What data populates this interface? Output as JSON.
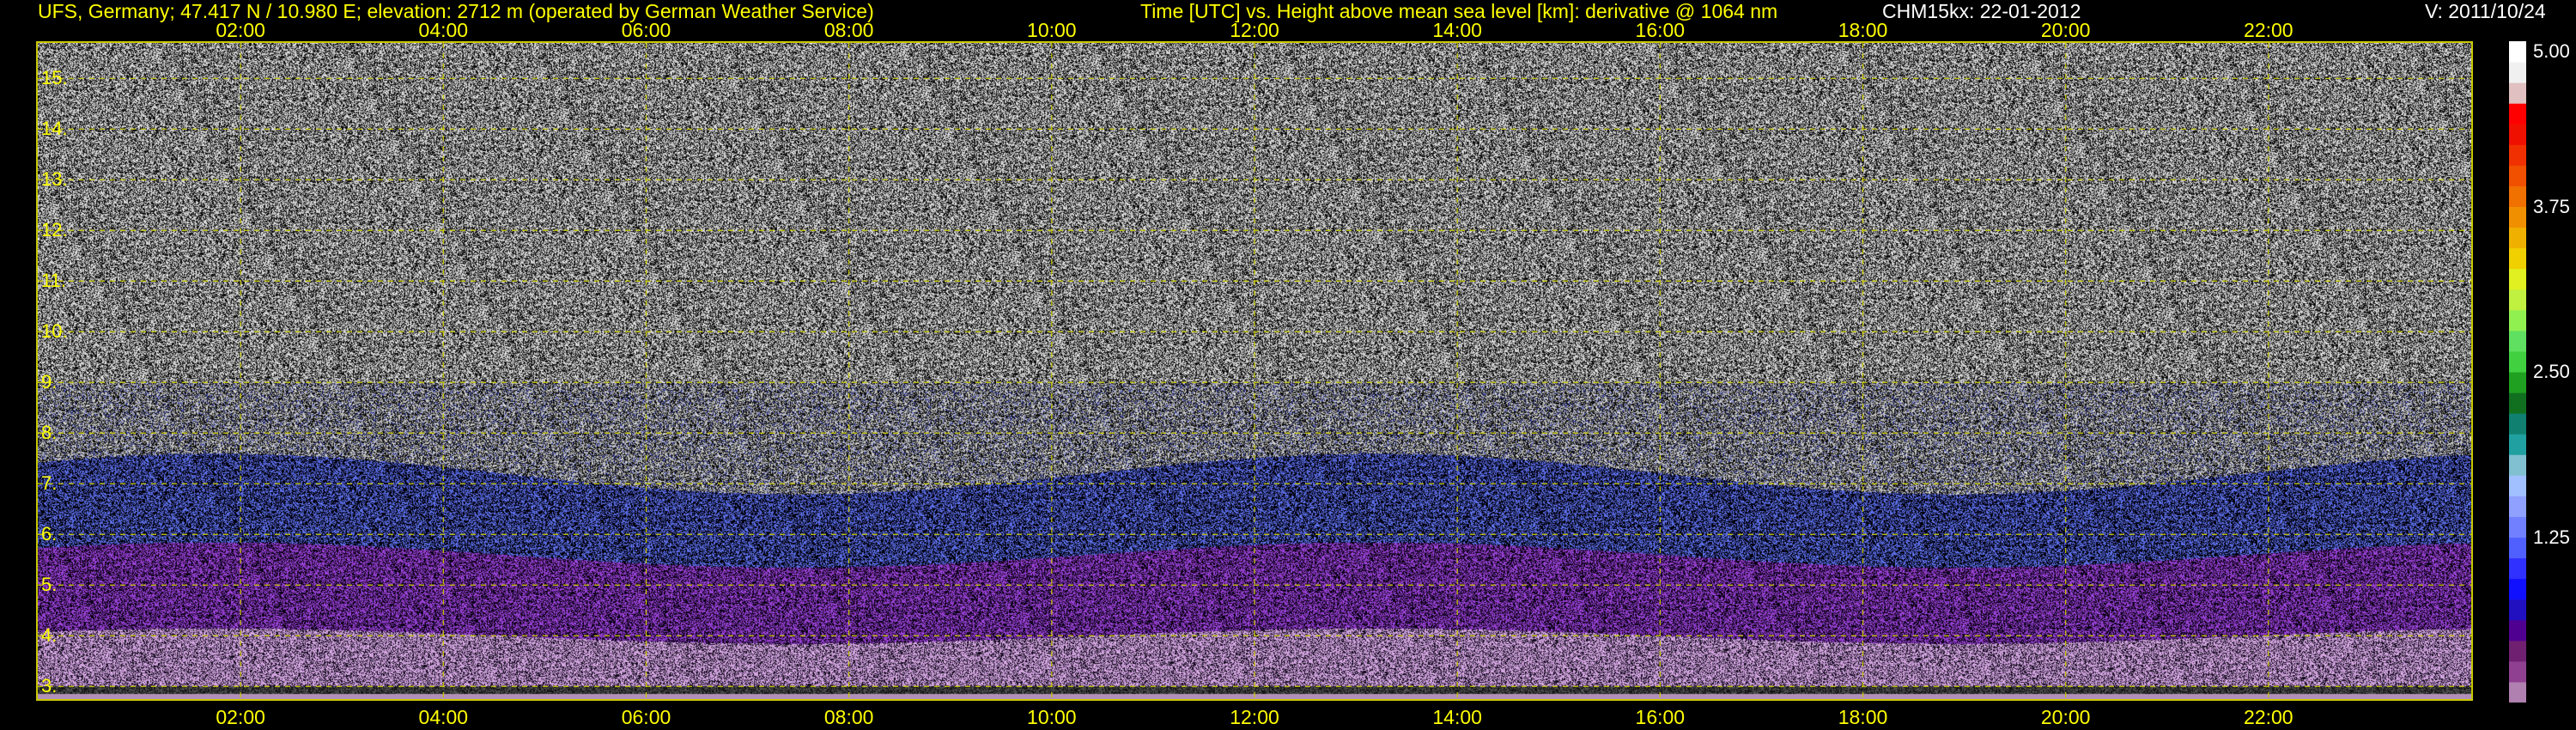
{
  "header": {
    "station": "UFS, Germany; 47.417 N / 10.980 E; elevation: 2712 m  (operated by German Weather Service)",
    "axes_title": "Time [UTC] vs. Height above mean sea level [km]: derivative @ 1064 nm",
    "instrument_date": "CHM15kx: 22-01-2012",
    "version": "V: 2011/10/24"
  },
  "chart_data": {
    "type": "heatmap",
    "xlabel": "Time [UTC]",
    "ylabel": "Height above mean sea level [km]",
    "x_ticks": [
      "02:00",
      "04:00",
      "06:00",
      "08:00",
      "10:00",
      "12:00",
      "14:00",
      "16:00",
      "18:00",
      "20:00",
      "22:00"
    ],
    "x_tick_hours": [
      2,
      4,
      6,
      8,
      10,
      12,
      14,
      16,
      18,
      20,
      22
    ],
    "xlim_hours": [
      0,
      24
    ],
    "y_ticks": [
      "3.",
      "4.",
      "5.",
      "6.",
      "7.",
      "8.",
      "9.",
      "10.",
      "11.",
      "12.",
      "13.",
      "14.",
      "15."
    ],
    "y_tick_values": [
      3,
      4,
      5,
      6,
      7,
      8,
      9,
      10,
      11,
      12,
      13,
      14,
      15
    ],
    "ylim": [
      2.75,
      15.7
    ],
    "grid": true,
    "colorbar": {
      "labels": [
        "5.00",
        "3.75",
        "2.50",
        "1.25"
      ],
      "values": [
        5.0,
        3.75,
        2.5,
        1.25
      ],
      "range": [
        0,
        5.0
      ],
      "colors": [
        "#b080b0",
        "#904090",
        "#702070",
        "#500090",
        "#2010c0",
        "#1010ff",
        "#3030ff",
        "#5060ff",
        "#7080ff",
        "#90a0ff",
        "#a0c0ff",
        "#80c0d0",
        "#20a0a0",
        "#108070",
        "#107020",
        "#20a020",
        "#40d040",
        "#60e060",
        "#90f050",
        "#c0f040",
        "#e0f020",
        "#f0d000",
        "#f0b000",
        "#f09000",
        "#f07000",
        "#f05000",
        "#f03000",
        "#f01000",
        "#ff0000",
        "#e0c0c0",
        "#f0f0f0",
        "#ffffff"
      ]
    },
    "profile": [
      {
        "height": 2.9,
        "signal": "black band"
      },
      {
        "height": 3.5,
        "signal": "light purple"
      },
      {
        "height": 4.8,
        "signal": "purple"
      },
      {
        "height": 6.0,
        "signal": "blue"
      },
      {
        "height": 8.0,
        "signal": "grey noise"
      },
      {
        "height": 15.5,
        "signal": "grey noise"
      }
    ]
  }
}
